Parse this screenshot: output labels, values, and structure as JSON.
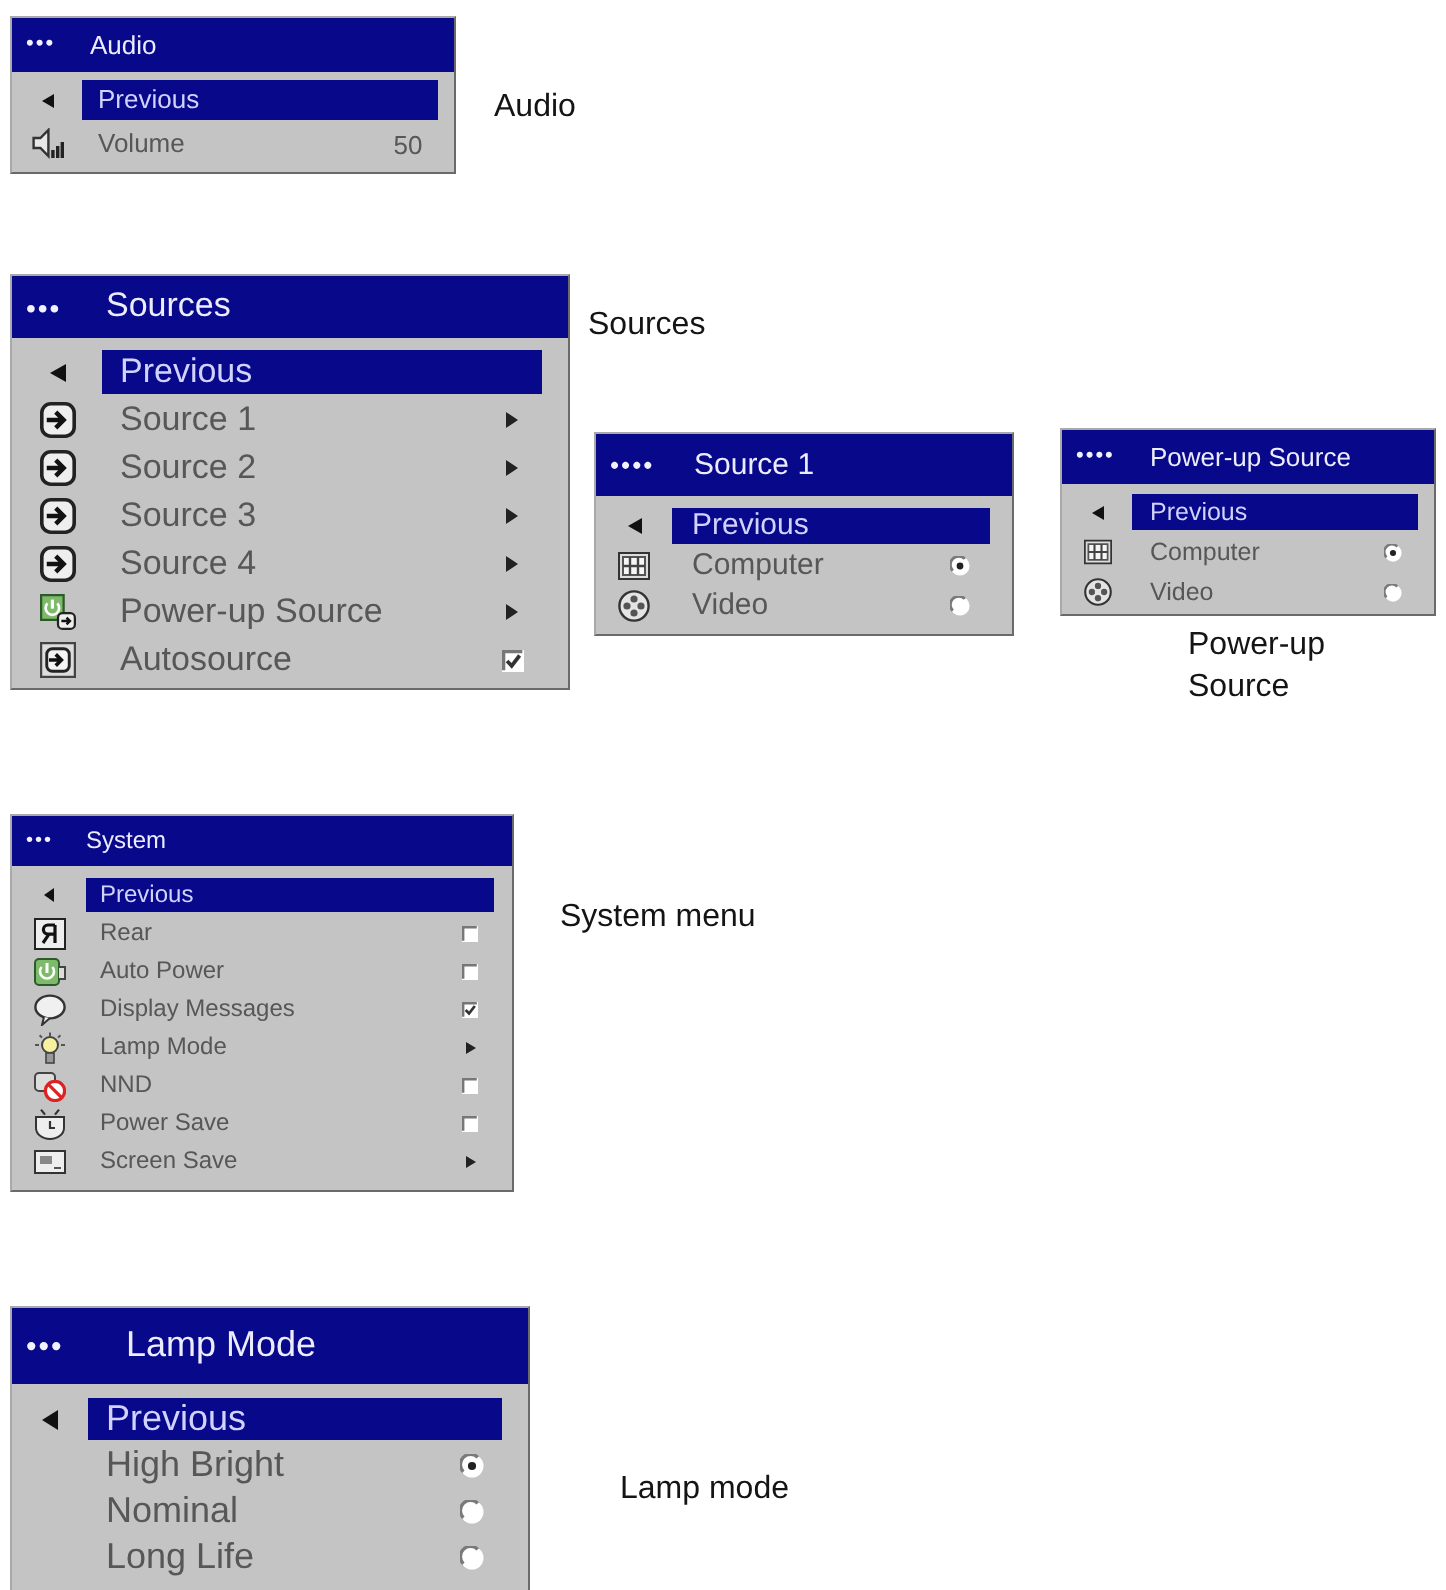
{
  "sections": [
    {
      "menus": [
        {
          "depth_marker": "•••",
          "title": "Audio",
          "caption": "Audio",
          "items": [
            {
              "kind": "back",
              "label": "Previous",
              "selected": true
            },
            {
              "kind": "value",
              "label": "Volume",
              "value": "50",
              "selected": false
            }
          ]
        }
      ]
    },
    {
      "menus": [
        {
          "depth_marker": "•••",
          "title": "Sources",
          "caption": "Sources",
          "items": [
            {
              "kind": "back",
              "label": "Previous",
              "selected": true
            },
            {
              "kind": "submenu",
              "label": "Source 1",
              "selected": false
            },
            {
              "kind": "submenu",
              "label": "Source 2",
              "selected": false
            },
            {
              "kind": "submenu",
              "label": "Source 3",
              "selected": false
            },
            {
              "kind": "submenu",
              "label": "Source 4",
              "selected": false
            },
            {
              "kind": "submenu",
              "label": "Power-up Source",
              "selected": false
            },
            {
              "kind": "checkbox",
              "label": "Autosource",
              "checked": true,
              "selected": false
            }
          ]
        },
        {
          "depth_marker": "••••",
          "title": "Source 1",
          "items": [
            {
              "kind": "back",
              "label": "Previous",
              "selected": true
            },
            {
              "kind": "radio",
              "label": "Computer",
              "checked": true,
              "selected": false
            },
            {
              "kind": "radio",
              "label": "Video",
              "checked": false,
              "selected": false
            }
          ]
        },
        {
          "depth_marker": "••••",
          "title": "Power-up Source",
          "caption": "Power-up Source",
          "items": [
            {
              "kind": "back",
              "label": "Previous",
              "selected": true
            },
            {
              "kind": "radio",
              "label": "Computer",
              "checked": true,
              "selected": false
            },
            {
              "kind": "radio",
              "label": "Video",
              "checked": false,
              "selected": false
            }
          ]
        }
      ]
    },
    {
      "menus": [
        {
          "depth_marker": "•••",
          "title": "System",
          "caption": "System menu",
          "items": [
            {
              "kind": "back",
              "label": "Previous",
              "selected": true
            },
            {
              "kind": "checkbox",
              "label": "Rear",
              "checked": false,
              "selected": false
            },
            {
              "kind": "checkbox",
              "label": "Auto Power",
              "checked": false,
              "selected": false
            },
            {
              "kind": "checkbox",
              "label": "Display Messages",
              "checked": true,
              "selected": false
            },
            {
              "kind": "submenu",
              "label": "Lamp Mode",
              "selected": false
            },
            {
              "kind": "checkbox",
              "label": "NND",
              "checked": false,
              "selected": false
            },
            {
              "kind": "checkbox",
              "label": "Power Save",
              "checked": false,
              "selected": false
            },
            {
              "kind": "submenu",
              "label": "Screen Save",
              "selected": false
            }
          ]
        }
      ]
    },
    {
      "menus": [
        {
          "depth_marker": "•••",
          "title": "Lamp Mode",
          "caption": "Lamp mode",
          "items": [
            {
              "kind": "back",
              "label": "Previous",
              "selected": true
            },
            {
              "kind": "radio",
              "label": "High Bright",
              "checked": true,
              "selected": false
            },
            {
              "kind": "radio",
              "label": "Nominal",
              "checked": false,
              "selected": false
            },
            {
              "kind": "radio",
              "label": "Long Life",
              "checked": false,
              "selected": false
            }
          ]
        }
      ]
    }
  ]
}
